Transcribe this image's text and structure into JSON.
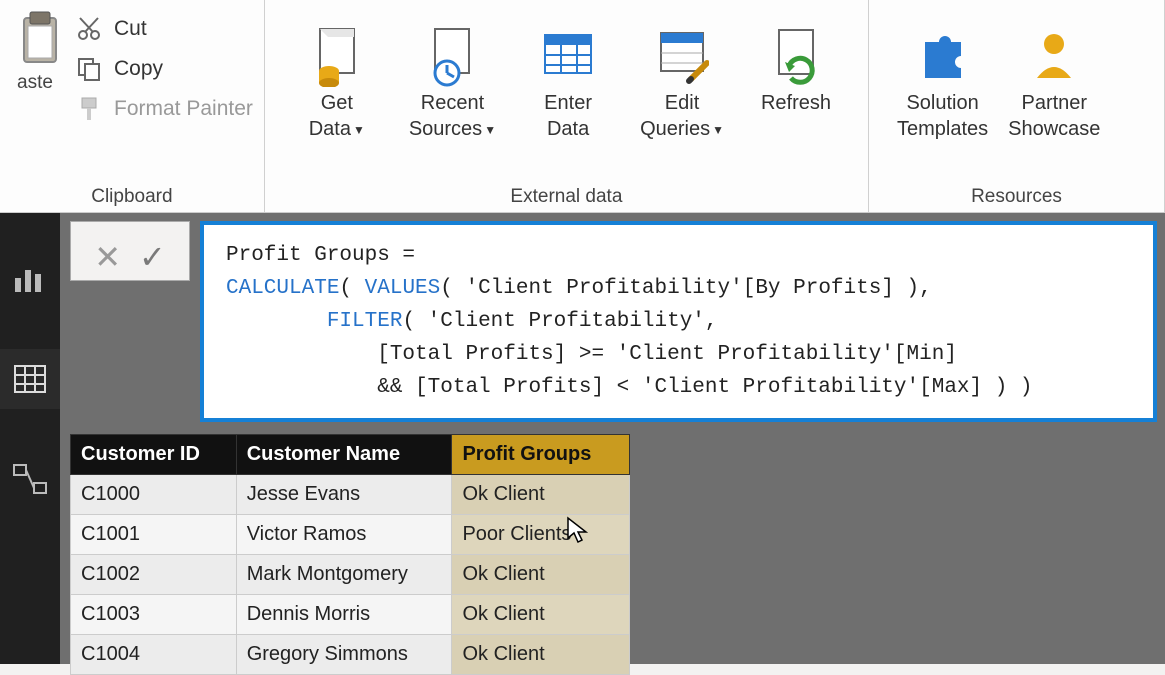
{
  "ribbon": {
    "clipboard": {
      "title": "Clipboard",
      "paste": "aste",
      "cut": "Cut",
      "copy": "Copy",
      "format_painter": "Format Painter"
    },
    "external_data": {
      "title": "External data",
      "get_data": {
        "l1": "Get",
        "l2": "Data"
      },
      "recent_sources": {
        "l1": "Recent",
        "l2": "Sources"
      },
      "enter_data": {
        "l1": "Enter",
        "l2": "Data"
      },
      "edit_queries": {
        "l1": "Edit",
        "l2": "Queries"
      },
      "refresh": {
        "l1": "Refresh",
        "l2": ""
      }
    },
    "resources": {
      "title": "Resources",
      "solution_templates": {
        "l1": "Solution",
        "l2": "Templates"
      },
      "partner_showcase": {
        "l1": "Partner",
        "l2": "Showcase"
      }
    }
  },
  "formula": {
    "line1": "Profit Groups =",
    "line2_a": "CALCULATE",
    "line2_b": "( ",
    "line2_c": "VALUES",
    "line2_d": "( 'Client Profitability'[By Profits] ),",
    "line3_a": "        ",
    "line3_b": "FILTER",
    "line3_c": "( 'Client Profitability',",
    "line4": "            [Total Profits] >= 'Client Profitability'[Min]",
    "line5": "            && [Total Profits] < 'Client Profitability'[Max] ) )"
  },
  "table": {
    "headers": [
      "Customer ID",
      "Customer Name",
      "Profit Groups"
    ],
    "rows": [
      {
        "id": "C1000",
        "name": "Jesse Evans",
        "group": "Ok Client"
      },
      {
        "id": "C1001",
        "name": "Victor Ramos",
        "group": "Poor Clients"
      },
      {
        "id": "C1002",
        "name": "Mark Montgomery",
        "group": "Ok Client"
      },
      {
        "id": "C1003",
        "name": "Dennis Morris",
        "group": "Ok Client"
      },
      {
        "id": "C1004",
        "name": "Gregory Simmons",
        "group": "Ok Client"
      }
    ]
  }
}
